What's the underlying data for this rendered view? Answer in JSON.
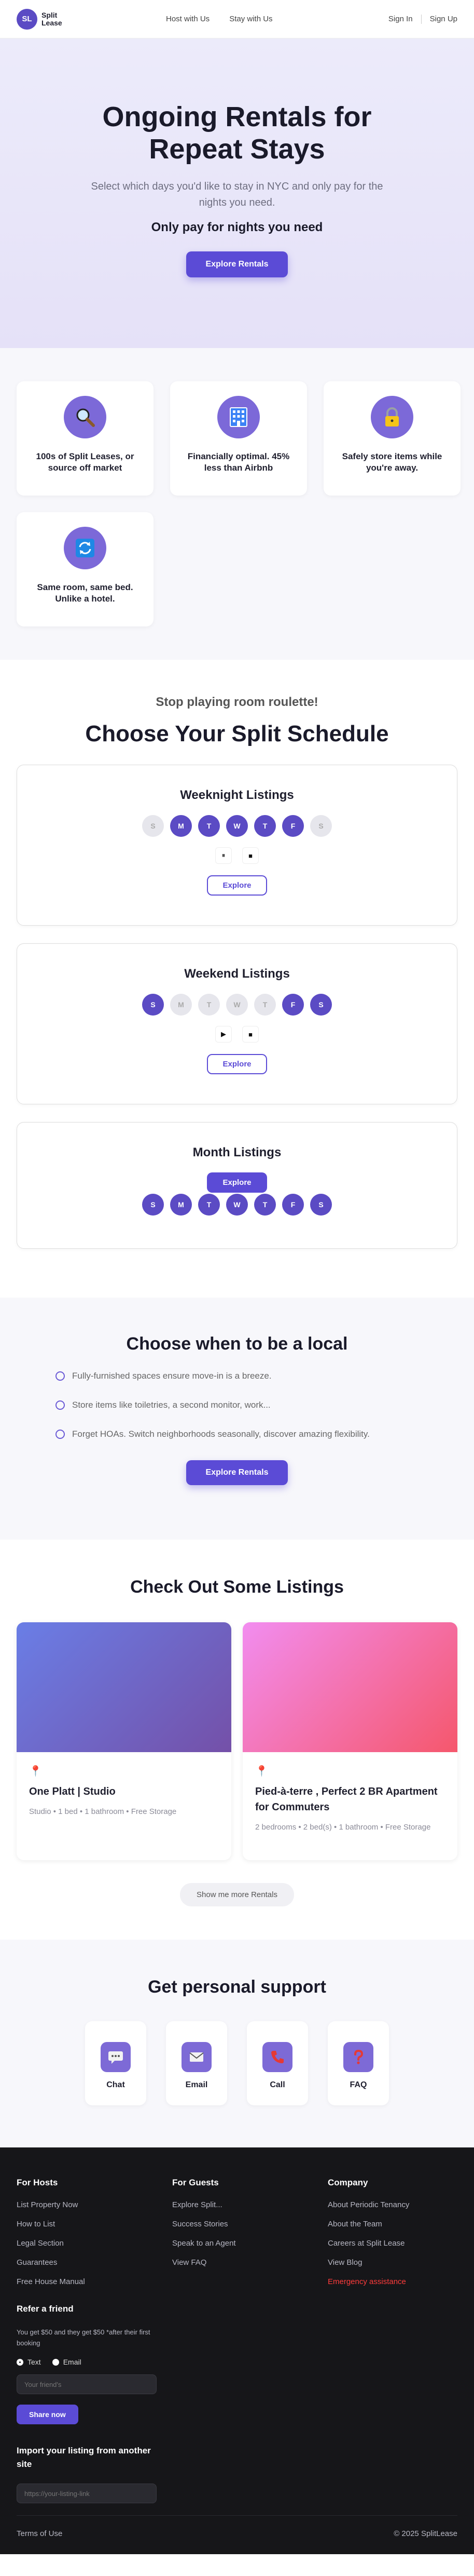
{
  "header": {
    "brand_initials": "SL",
    "brand_name": "Split Lease",
    "nav_center": [
      "Host with Us",
      "Stay with Us"
    ],
    "sign_in": "Sign In",
    "sign_up": "Sign Up"
  },
  "hero": {
    "title": "Ongoing Rentals for Repeat Stays",
    "subtitle": "Select which days you'd like to stay in NYC and only pay for the nights you need.",
    "tagline": "Only pay for nights you need",
    "cta": "Explore Rentals"
  },
  "features": [
    {
      "text": "100s of Split Leases, or source off market",
      "icon": "magnifier-icon"
    },
    {
      "text": "Financially optimal. 45% less than Airbnb",
      "icon": "building-icon"
    },
    {
      "text": "Safely store items while you're away.",
      "icon": "lock-icon"
    },
    {
      "text": "Same room, same bed. Unlike a hotel.",
      "icon": "repeat-icon"
    }
  ],
  "schedule": {
    "kicker": "Stop playing room roulette!",
    "title": "Choose Your Split Schedule",
    "cards": [
      {
        "title": "Weeknight Listings",
        "days": [
          "S",
          "M",
          "T",
          "W",
          "T",
          "F",
          "S"
        ],
        "active": [
          false,
          true,
          true,
          true,
          true,
          true,
          false
        ],
        "controls": [
          "⏸",
          "■"
        ],
        "cta": "Explore"
      },
      {
        "title": "Weekend Listings",
        "days": [
          "S",
          "M",
          "T",
          "W",
          "T",
          "F",
          "S"
        ],
        "active": [
          true,
          false,
          false,
          false,
          false,
          true,
          true
        ],
        "controls": [
          "▶",
          "■"
        ],
        "cta": "Explore"
      },
      {
        "title": "Month Listings",
        "days": [
          "S",
          "M",
          "T",
          "W",
          "T",
          "F",
          "S"
        ],
        "active": [
          true,
          true,
          true,
          true,
          true,
          true,
          true
        ],
        "cta": "Explore"
      }
    ]
  },
  "local": {
    "title": "Choose when to be a local",
    "items": [
      "Fully-furnished spaces ensure move-in is a breeze.",
      "Store items like toiletries, a second monitor, work...",
      "Forget HOAs. Switch neighborhoods seasonally, discover amazing flexibility."
    ],
    "cta": "Explore Rentals"
  },
  "listings": {
    "title": "Check Out Some Listings",
    "items": [
      {
        "title": "One Platt | Studio",
        "meta": "Studio • 1 bed • 1 bathroom • Free Storage"
      },
      {
        "title": "Pied-à-terre , Perfect 2 BR Apartment for Commuters",
        "meta": "2 bedrooms • 2 bed(s) • 1 bathroom • Free Storage"
      }
    ],
    "more": "Show me more Rentals"
  },
  "support": {
    "title": "Get personal support",
    "items": [
      {
        "label": "Chat",
        "icon": "chat-icon"
      },
      {
        "label": "Email",
        "icon": "email-icon"
      },
      {
        "label": "Call",
        "icon": "phone-icon"
      },
      {
        "label": "FAQ",
        "icon": "question-icon"
      }
    ]
  },
  "footer": {
    "hosts": {
      "title": "For Hosts",
      "links": [
        "List Property Now",
        "How to List",
        "Legal Section",
        "Guarantees",
        "Free House Manual"
      ]
    },
    "guests": {
      "title": "For Guests",
      "links": [
        "Explore Split...",
        "Success Stories",
        "Speak to an Agent",
        "View FAQ"
      ]
    },
    "company": {
      "title": "Company",
      "links": [
        "About Periodic Tenancy",
        "About the Team",
        "Careers at Split Lease",
        "View Blog"
      ],
      "alert": "Emergency assistance"
    },
    "refer": {
      "title": "Refer a friend",
      "text": "You get $50 and they get $50 *after their first booking",
      "option_text": "Text",
      "option_email": "Email",
      "placeholder": "Your friend's",
      "cta": "Share now"
    },
    "import": {
      "title": "Import your listing from another site",
      "placeholder": "https://your-listing-link"
    },
    "terms": "Terms of Use",
    "copyright": "© 2025 SplitLease"
  },
  "colors": {
    "accent": "#5b4bd6",
    "footer_bg": "#161619",
    "alert": "#ff3b3b"
  }
}
